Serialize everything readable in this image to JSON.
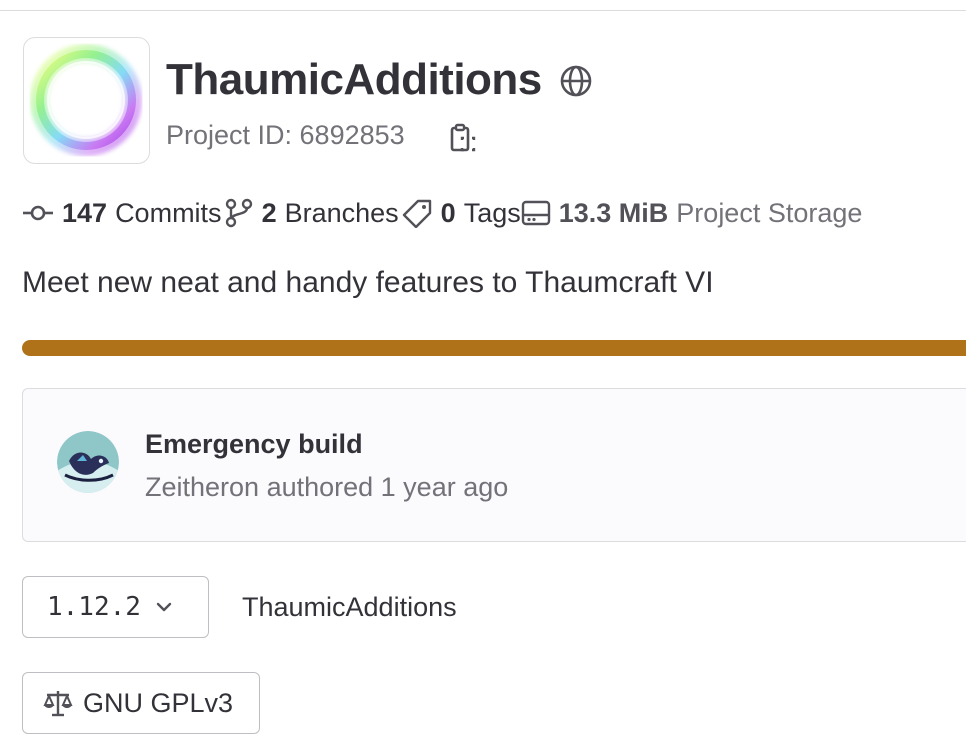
{
  "project": {
    "name": "ThaumicAdditions",
    "id_label": "Project ID: 6892853",
    "visibility_icon": "globe-icon",
    "copy_icon": "copy-to-clipboard-icon",
    "description": "Meet new neat and handy features to Thaumcraft VI"
  },
  "stats": {
    "commits": {
      "count": "147",
      "label": "Commits",
      "icon": "commit-icon"
    },
    "branches": {
      "count": "2",
      "label": "Branches",
      "icon": "branch-icon"
    },
    "tags": {
      "count": "0",
      "label": "Tags",
      "icon": "tag-icon"
    },
    "storage": {
      "value": "13.3 MiB",
      "label": "Project Storage",
      "icon": "storage-icon"
    }
  },
  "language_bar": {
    "color": "#b07219",
    "fraction": 1.0
  },
  "last_commit": {
    "title": "Emergency build",
    "meta": "Zeitheron authored 1 year ago"
  },
  "repository": {
    "ref": "1.12.2",
    "path_root": "ThaumicAdditions"
  },
  "license": {
    "label": "GNU GPLv3",
    "icon": "scale-icon"
  }
}
